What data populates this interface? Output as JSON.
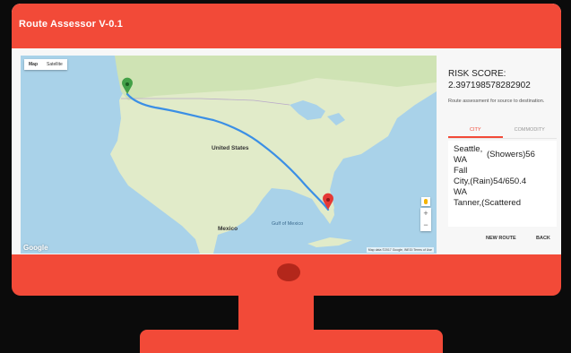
{
  "app": {
    "title": "Route Assessor V-0.1"
  },
  "map": {
    "type_toggle": [
      "Map",
      "Satellite"
    ],
    "active_type": "Map",
    "labels": {
      "country_us": "United States",
      "country_mx": "Mexico",
      "gulf": "Gulf of Mexico"
    },
    "logo": "Google",
    "attribution": "Map data ©2017 Google, INEGI   Terms of Use",
    "zoom_in": "+",
    "zoom_out": "−",
    "origin": "Seattle, WA",
    "destination": "Florida"
  },
  "panel": {
    "risk_label": "RISK SCORE:",
    "risk_value": "2.397198578282902",
    "description": "Route assessment for source to destination.",
    "tabs": [
      "CITY",
      "COMMODITY"
    ],
    "active_tab": "CITY",
    "city_lines": [
      "Seattle,",
      "WA",
      "(Showers)56",
      "Fall",
      "City,(Rain)54/650.4",
      "WA",
      "Tanner,(Scattered"
    ],
    "buttons": {
      "new_route": "NEW ROUTE",
      "back": "BACK"
    }
  },
  "colors": {
    "accent": "#f24a38",
    "route": "#3b8fe5",
    "water": "#a9d2e9",
    "land": "#dfe9c8"
  }
}
